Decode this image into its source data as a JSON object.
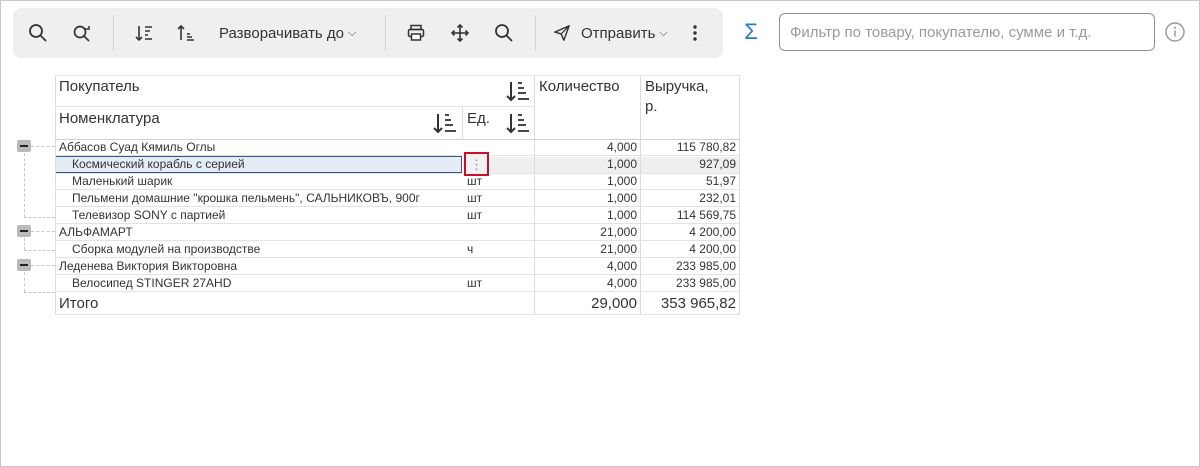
{
  "toolbar": {
    "expand_label": "Разворачивать до",
    "send_label": "Отправить"
  },
  "filter": {
    "placeholder": "Фильтр по товару, покупателю, сумме и т.д."
  },
  "sigma": "Σ",
  "table": {
    "headers": {
      "buyer": "Покупатель",
      "nomenclature": "Номенклатура",
      "unit": "Ед.",
      "quantity": "Количество",
      "revenue_line1": "Выручка,",
      "revenue_line2": "р."
    },
    "rows": [
      {
        "level": 0,
        "name": "Аббасов Суад Кямиль Оглы",
        "unit": "",
        "qty": "4,000",
        "revenue": "115 780,82"
      },
      {
        "level": 1,
        "name": "Космический корабль с серией",
        "unit": "",
        "qty": "1,000",
        "revenue": "927,09"
      },
      {
        "level": 1,
        "name": "Маленький шарик",
        "unit": "шт",
        "qty": "1,000",
        "revenue": "51,97"
      },
      {
        "level": 1,
        "name": "Пельмени домашние \"крошка пельмень\", САЛЬНИКОВЪ, 900г",
        "unit": "шт",
        "qty": "1,000",
        "revenue": "232,01"
      },
      {
        "level": 1,
        "name": "Телевизор SONY с партией",
        "unit": "шт",
        "qty": "1,000",
        "revenue": "114 569,75"
      },
      {
        "level": 0,
        "name": "АЛЬФАМАРТ",
        "unit": "",
        "qty": "21,000",
        "revenue": "4 200,00"
      },
      {
        "level": 1,
        "name": "Сборка модулей на производстве",
        "unit": "ч",
        "qty": "21,000",
        "revenue": "4 200,00"
      },
      {
        "level": 0,
        "name": "Леденева Виктория Викторовна",
        "unit": "",
        "qty": "4,000",
        "revenue": "233 985,00"
      },
      {
        "level": 1,
        "name": "Велосипед STINGER 27AHD",
        "unit": "шт",
        "qty": "4,000",
        "revenue": "233 985,00"
      }
    ],
    "total": {
      "label": "Итого",
      "qty": "29,000",
      "revenue": "353 965,82"
    }
  }
}
